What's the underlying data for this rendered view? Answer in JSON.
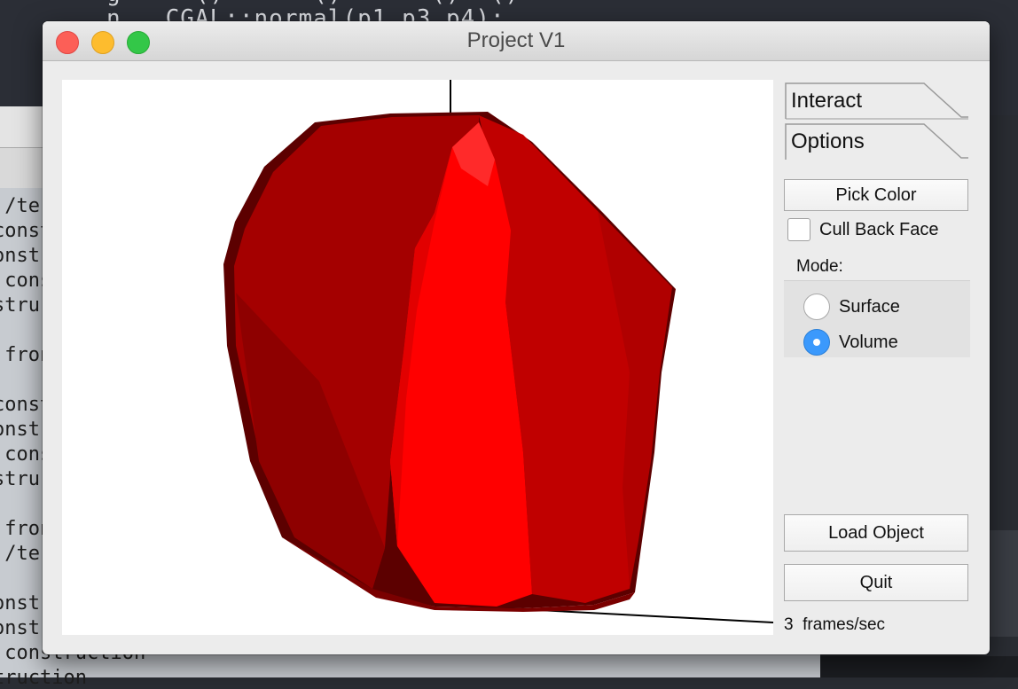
{
  "background": {
    "editor_code_line": "n   CGAL::normal(p1,p3,p4);",
    "editor_code_top": "g     ()      ()      ()  ()",
    "terminal_lines": [
      "./te",
      "const",
      "onst",
      " cons",
      "stru",
      "",
      " fron",
      "",
      "const",
      "onst",
      " cons",
      "stru",
      "",
      " fron",
      "./te",
      "",
      "onst",
      "onst",
      " construction",
      "truction"
    ]
  },
  "window": {
    "title": "Project V1",
    "controls": {
      "close_icon": "close-icon",
      "minimize_icon": "minimize-icon",
      "maximize_icon": "maximize-icon"
    }
  },
  "viewport": {
    "object_color": "#ff0000",
    "background": "#ffffff"
  },
  "panel": {
    "tabs": [
      {
        "label": "Interact"
      },
      {
        "label": "Options"
      }
    ],
    "pick_color_label": "Pick Color",
    "cull_back_face": {
      "label": "Cull Back Face",
      "checked": false
    },
    "mode": {
      "label": "Mode:",
      "options": [
        {
          "label": "Surface",
          "selected": false
        },
        {
          "label": "Volume",
          "selected": true
        }
      ]
    },
    "load_object_label": "Load Object",
    "quit_label": "Quit",
    "fps_value": "3",
    "fps_unit": "frames/sec"
  }
}
